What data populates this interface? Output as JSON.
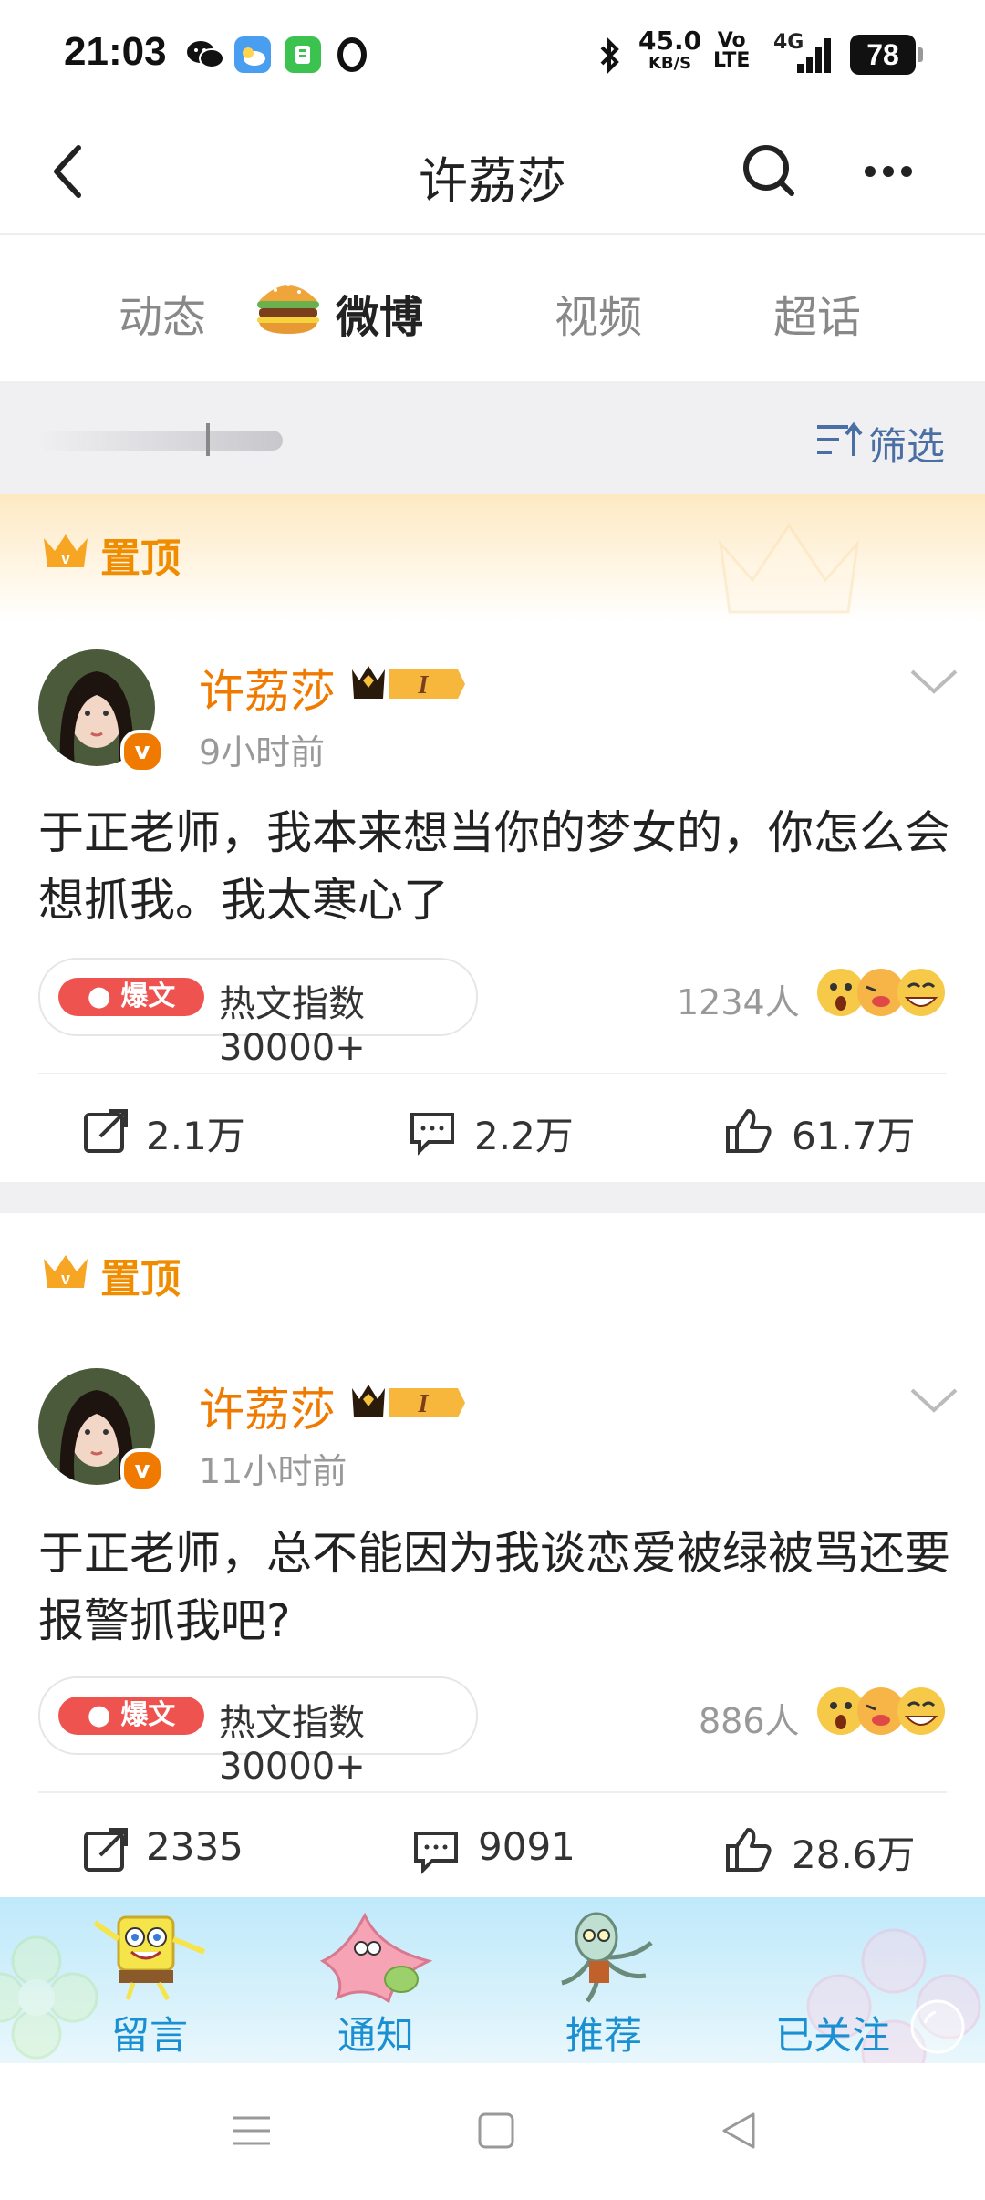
{
  "status": {
    "time": "21:03",
    "net_speed_value": "45.0",
    "net_speed_unit": "KB/S",
    "volte_top": "Vo",
    "volte_bottom": "LTE",
    "network": "4G",
    "battery": "78"
  },
  "nav": {
    "title": "许荔莎"
  },
  "tabs": [
    {
      "label": "动态"
    },
    {
      "label": "微博"
    },
    {
      "label": "视频"
    },
    {
      "label": "超话"
    }
  ],
  "filter": {
    "label": "筛选"
  },
  "posts": [
    {
      "pin_label": "置顶",
      "username": "许荔莎",
      "level_badge": "I",
      "time": "9小时前",
      "content": "于正老师，我本来想当你的梦女的，你怎么会想抓我。我太寒心了",
      "hot_badge": "爆文",
      "hot_text": "热文指数30000+",
      "reaction_count": "1234人",
      "actions": {
        "repost": "2.1万",
        "comment": "2.2万",
        "like": "61.7万"
      }
    },
    {
      "pin_label": "置顶",
      "username": "许荔莎",
      "level_badge": "I",
      "time": "11小时前",
      "content": "于正老师，总不能因为我谈恋爱被绿被骂还要报警抓我吧?",
      "hot_badge": "爆文",
      "hot_text": "热文指数30000+",
      "reaction_count": "886人",
      "actions": {
        "repost": "2335",
        "comment": "9091",
        "like": "28.6万"
      }
    }
  ],
  "bottom_tabs": [
    {
      "label": "留言"
    },
    {
      "label": "通知"
    },
    {
      "label": "推荐"
    },
    {
      "label": "已关注"
    }
  ],
  "colors": {
    "accent_orange": "#f07a00",
    "link_blue": "#4a6fa5",
    "hot_red": "#ef5350"
  }
}
